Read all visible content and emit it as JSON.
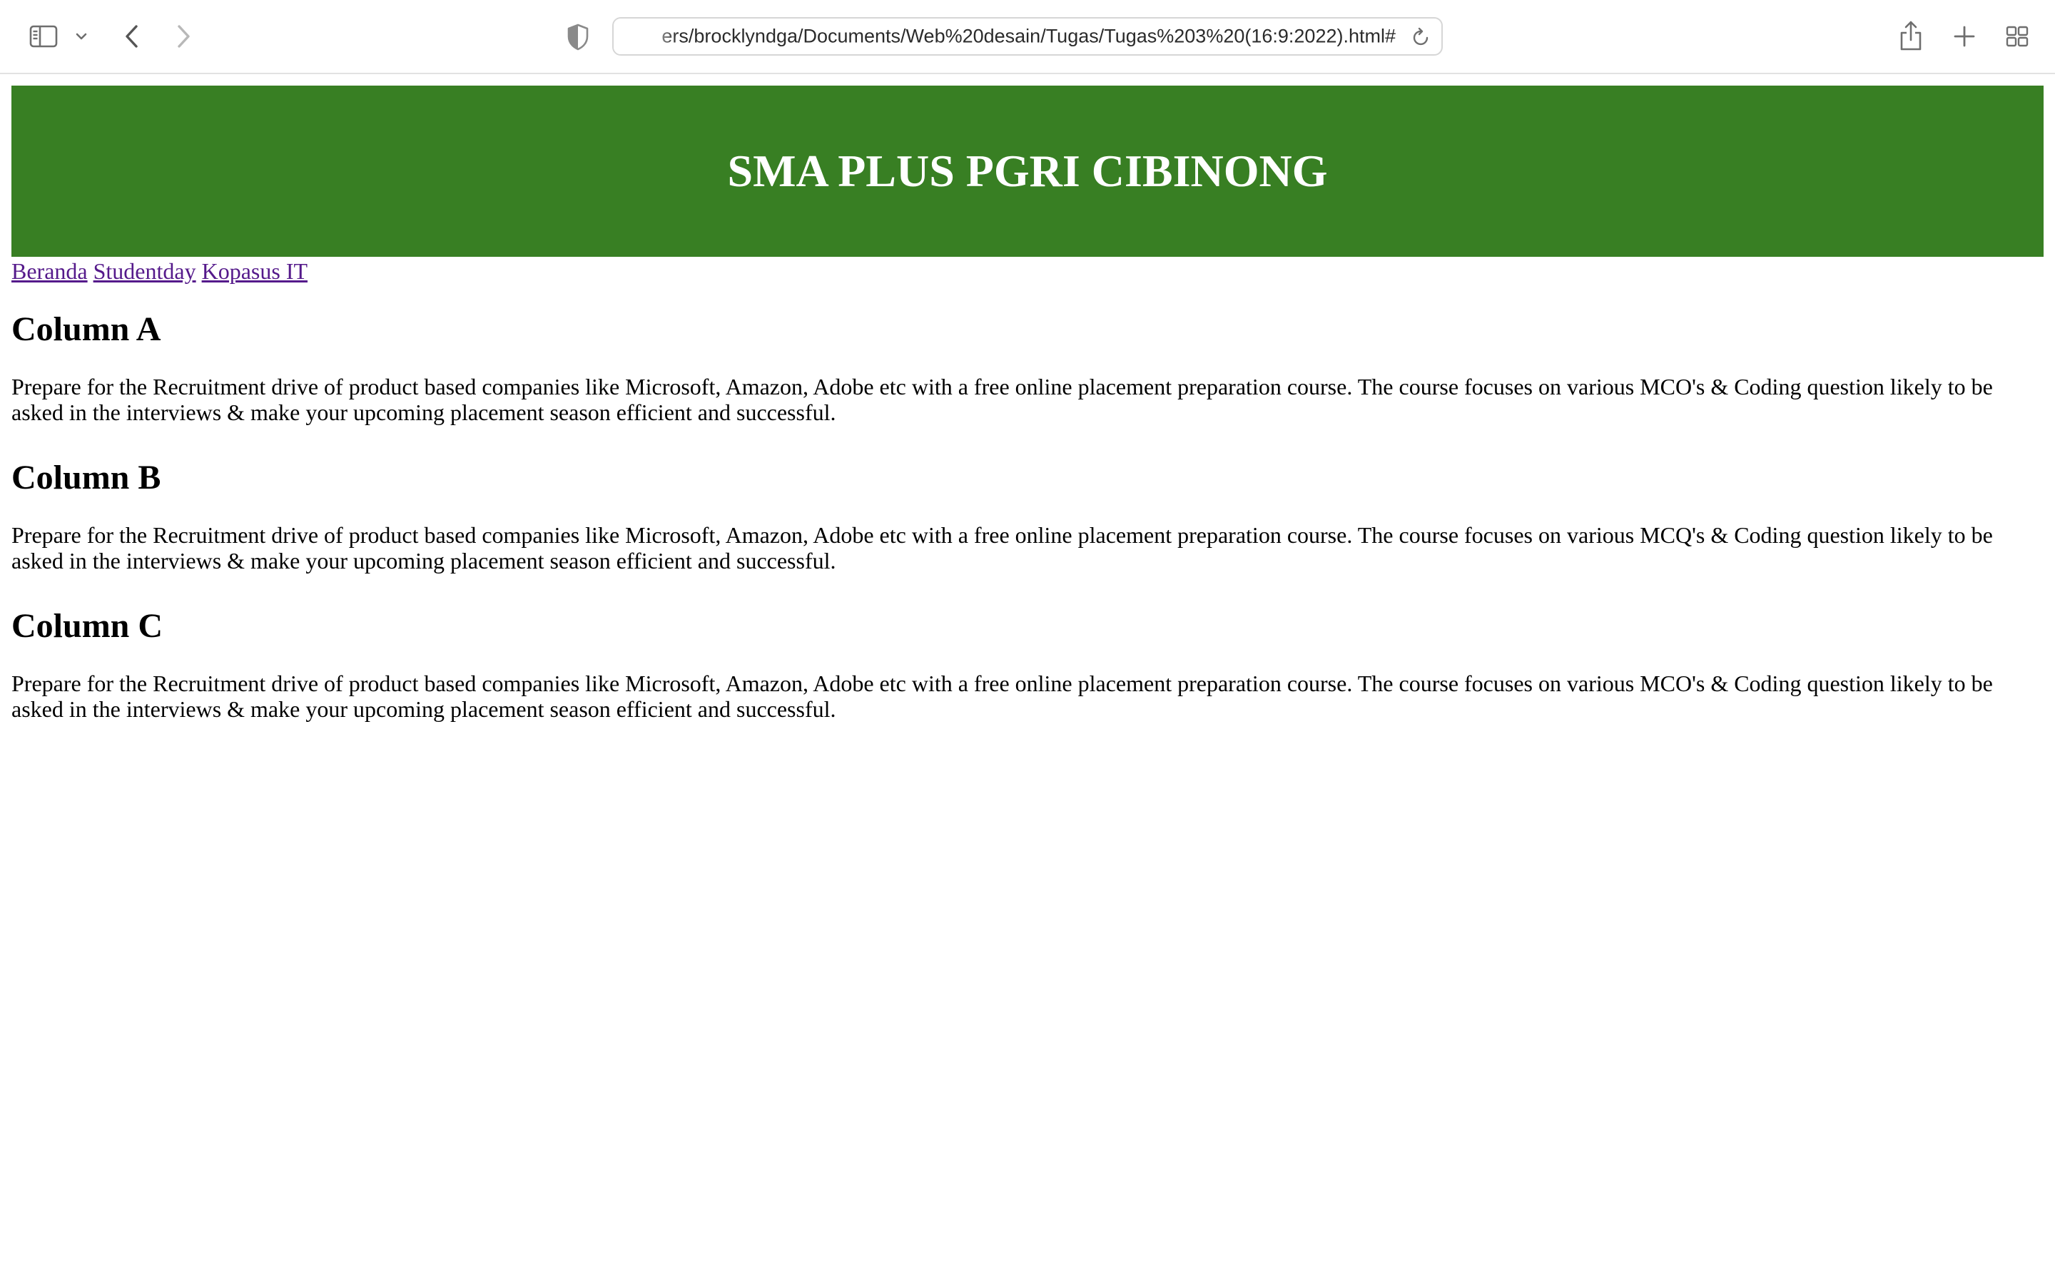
{
  "browser": {
    "address": "ers/brocklyndga/Documents/Web%20desain/Tugas/Tugas%203%20(16:9:2022).html#",
    "icons": {
      "sidebar": "sidebar-icon",
      "sidebar_menu": "chevron-down-icon",
      "back": "chevron-left-icon",
      "forward": "chevron-right-icon",
      "privacy": "shield-icon",
      "reload": "reload-icon",
      "share": "share-icon",
      "new_tab": "plus-icon",
      "tab_overview": "grid-icon"
    }
  },
  "page": {
    "header": {
      "title": "SMA PLUS PGRI CIBINONG",
      "background": "#387f23"
    },
    "nav": {
      "links": [
        "Beranda",
        "Studentday",
        "Kopasus IT"
      ],
      "link_color": "#551a8b"
    },
    "sections": [
      {
        "heading": "Column A",
        "text": "Prepare for the Recruitment drive of product based companies like Microsoft, Amazon, Adobe etc with a free online placement preparation course. The course focuses on various MCO's & Coding question likely to be asked in the interviews & make your upcoming placement season efficient and successful."
      },
      {
        "heading": "Column B",
        "text": "Prepare for the Recruitment drive of product based companies like Microsoft, Amazon, Adobe etc with a free online placement preparation course. The course focuses on various MCQ's & Coding question likely to be asked in the interviews & make your upcoming placement season efficient and successful."
      },
      {
        "heading": "Column C",
        "text": "Prepare for the Recruitment drive of product based companies like Microsoft, Amazon, Adobe etc with a free online placement preparation course. The course focuses on various MCO's & Coding question likely to be asked in the interviews & make your upcoming placement season efficient and successful."
      }
    ]
  }
}
